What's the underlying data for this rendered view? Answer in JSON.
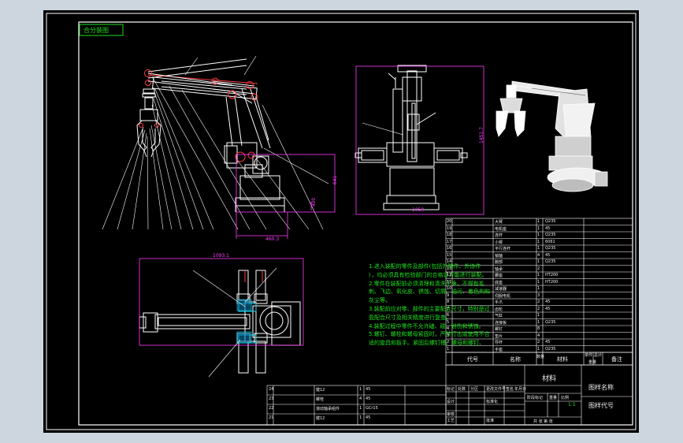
{
  "corner_label": "合分装图",
  "tech_notes": [
    "1.进入装配的零件及部件(包括外购件、外协件",
    "），均必须具有检验部门的合格证方能进行装配。",
    "2.零件在装配前必须清理和清洗干净，不得有毛",
    "刺、飞边、氧化皮、锈蚀、切屑、油污、着色剂和",
    "灰尘等。",
    "3.装配前应对零、部件的主要配合尺寸，特别是过",
    "盈配合尺寸及相关精度进行复查。",
    "4.装配过程中零件不允许磕、碰、划伤和锈蚀。",
    "5.螺钉、螺栓和螺母紧固时，严禁打击或使用不合",
    "适的旋具和扳手。紧固后螺钉槽、螺母和螺钉、"
  ],
  "dimensions": {
    "front_width": "460.3",
    "front_height": "641",
    "front_small": "400",
    "side_width": "1059",
    "side_height": "1451.7",
    "top_width": "1093.1"
  },
  "title_block": {
    "material": "材料",
    "drawing_name": "图样名称",
    "drawing_code": "图样代号",
    "scale": "1:1",
    "header": {
      "code": "代号",
      "name": "名称",
      "qty": "数量",
      "material": "材料",
      "unit_weight": "单件",
      "total_weight": "总计",
      "weight": "重量",
      "remark": "备注"
    },
    "sign": {
      "mark": "标记",
      "count": "处数",
      "zone": "分区",
      "change_doc": "更改文件号",
      "signature": "签名",
      "date": "年月日",
      "design": "设计",
      "standardize": "标准化",
      "stage_mark": "阶段标记",
      "weight_label": "重量",
      "scale_label": "比例",
      "review": "审核",
      "process": "工艺",
      "approve": "批准",
      "sheet": "共 张 第 张"
    }
  },
  "parts_right": [
    {
      "no": "20",
      "name": "大臂",
      "qty": "1",
      "mat": "Q235"
    },
    {
      "no": "19",
      "name": "电机座",
      "qty": "1",
      "mat": "45"
    },
    {
      "no": "18",
      "name": "连杆",
      "qty": "1",
      "mat": "Q235"
    },
    {
      "no": "17",
      "name": "小臂",
      "qty": "1",
      "mat": "6061"
    },
    {
      "no": "16",
      "name": "平行连杆",
      "qty": "1",
      "mat": "Q235"
    },
    {
      "no": "15",
      "name": "销轴",
      "qty": "4",
      "mat": "45"
    },
    {
      "no": "14",
      "name": "腕部",
      "qty": "1",
      "mat": "Q235"
    },
    {
      "no": "13",
      "name": "轴承",
      "qty": "2",
      "mat": ""
    },
    {
      "no": "12",
      "name": "腰座",
      "qty": "1",
      "mat": "HT200"
    },
    {
      "no": "11",
      "name": "底座",
      "qty": "1",
      "mat": "HT200"
    },
    {
      "no": "10",
      "name": "减速器",
      "qty": "1",
      "mat": ""
    },
    {
      "no": "9",
      "name": "伺服电机",
      "qty": "3",
      "mat": ""
    },
    {
      "no": "8",
      "name": "手爪",
      "qty": "2",
      "mat": "45"
    },
    {
      "no": "7",
      "name": "齿轮",
      "qty": "2",
      "mat": "45"
    },
    {
      "no": "6",
      "name": "气缸",
      "qty": "1",
      "mat": ""
    },
    {
      "no": "5",
      "name": "连接板",
      "qty": "1",
      "mat": "Q235"
    },
    {
      "no": "4",
      "name": "螺钉",
      "qty": "8",
      "mat": ""
    },
    {
      "no": "3",
      "name": "垫片",
      "qty": "4",
      "mat": ""
    },
    {
      "no": "2",
      "name": "导杆",
      "qty": "2",
      "mat": "45"
    },
    {
      "no": "1",
      "name": "手座",
      "qty": "1",
      "mat": "Q235"
    }
  ],
  "parts_bottom": [
    {
      "no": "24",
      "name": "键12",
      "qty": "1",
      "mat": "45"
    },
    {
      "no": "23",
      "name": "螺栓",
      "qty": "4",
      "mat": "45"
    },
    {
      "no": "22",
      "name": "滚动轴承组件",
      "qty": "1",
      "mat": "GCr15"
    },
    {
      "no": "21",
      "name": "键12",
      "qty": "1",
      "mat": "45"
    }
  ]
}
